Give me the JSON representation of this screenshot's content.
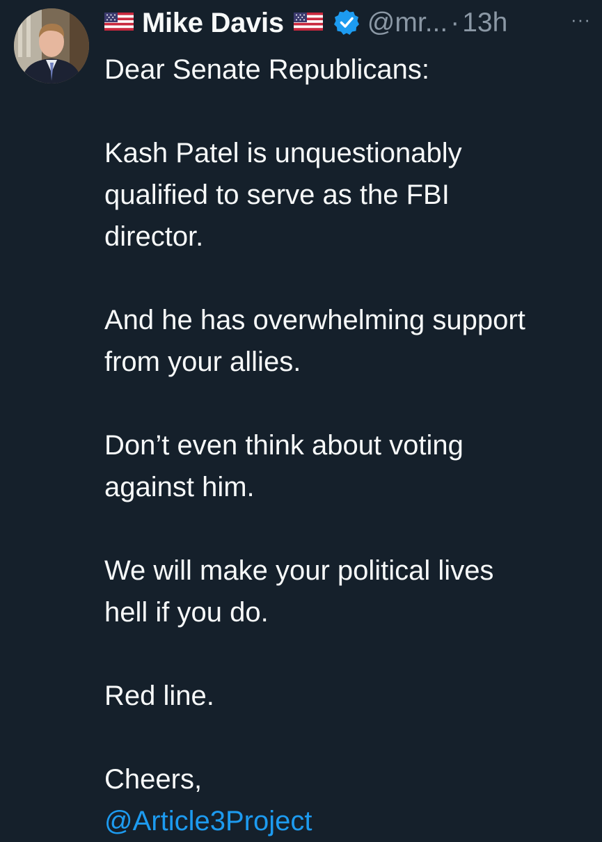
{
  "tweet": {
    "author_name": "Mike Davis",
    "name_prefix_emoji": "us-flag-icon",
    "name_suffix_emoji": "us-flag-icon",
    "verified": true,
    "handle": "@mr...",
    "separator": "·",
    "time": "13h",
    "more_label": "···",
    "lines": [
      "Dear Senate Republicans:",
      "",
      "Kash Patel is unquestionably",
      "qualified to serve as the FBI",
      "director.",
      "",
      "And he has overwhelming support",
      "from your allies.",
      "",
      "Don’t even think about voting",
      "against him.",
      "",
      "We will make your political lives",
      "hell if you do.",
      "",
      "Red line.",
      "",
      "Cheers,"
    ],
    "mention": "@Article3Project"
  },
  "colors": {
    "background": "#15202b",
    "text": "#f7f9f9",
    "secondary": "#8b98a5",
    "accent": "#1d9bf0"
  }
}
